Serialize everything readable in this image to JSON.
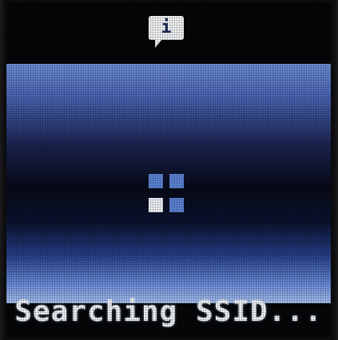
{
  "device_screen": {
    "info_icon": {
      "glyph": "i",
      "icon": "info-speech-bubble-icon"
    },
    "loading_indicator": {
      "icon": "four-square-spinner-icon",
      "active_cell": "bottom-left"
    },
    "status_message": "Searching SSID..."
  },
  "colors": {
    "panel_highlight": "#6f8fd6",
    "panel_dark": "#070a18",
    "spinner_blue": "#5d86d8",
    "spinner_active": "#f2f5fb",
    "text": "#f3f6fc"
  }
}
